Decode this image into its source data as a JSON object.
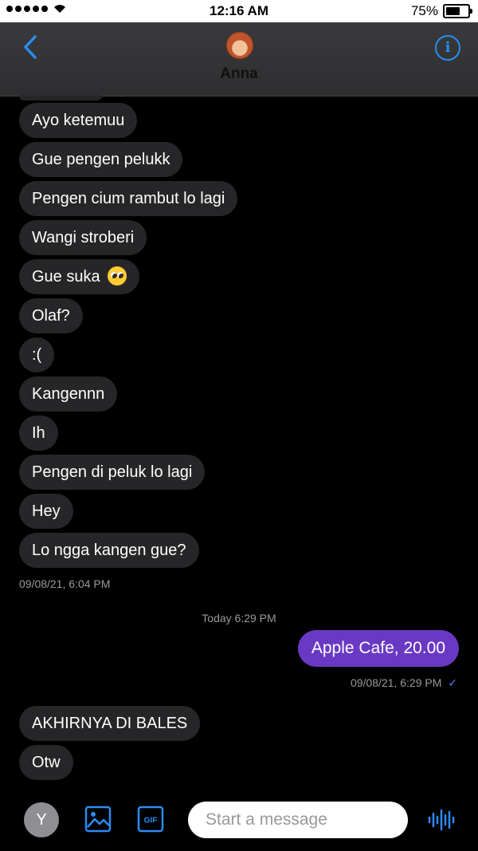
{
  "status_bar": {
    "time": "12:16 AM",
    "battery": "75%",
    "battery_level": 0.75
  },
  "header": {
    "contact_name": "Anna",
    "back_icon": "chevron-left-icon",
    "info_icon": "info-icon",
    "info_glyph": "i"
  },
  "messages": {
    "received": [
      "Ayo ketemuu",
      "Gue pengen pelukk",
      "Pengen cium rambut lo lagi",
      "Wangi stroberi",
      "Gue suka",
      "Olaf?",
      ":(",
      "Kangennn",
      "Ih",
      "Pengen di peluk lo lagi",
      "Hey",
      "Lo ngga kangen gue?"
    ],
    "received_timestamp": "09/08/21, 6:04 PM",
    "day_divider": "Today 6:29 PM",
    "sent": "Apple Cafe, 20.00",
    "sent_timestamp": "09/08/21, 6:29 PM",
    "sent_status": "✓",
    "later_received": [
      "AKHIRNYA DI BALES",
      "Otw"
    ]
  },
  "composer": {
    "avatar_initial": "Y",
    "image_icon": "image-icon",
    "gif_label": "GIF",
    "placeholder": "Start a message",
    "voice_icon": "voice-waveform-icon"
  },
  "colors": {
    "accent": "#2a8cf4",
    "sent_bubble": "#6a39c4",
    "received_bubble": "#262628"
  }
}
